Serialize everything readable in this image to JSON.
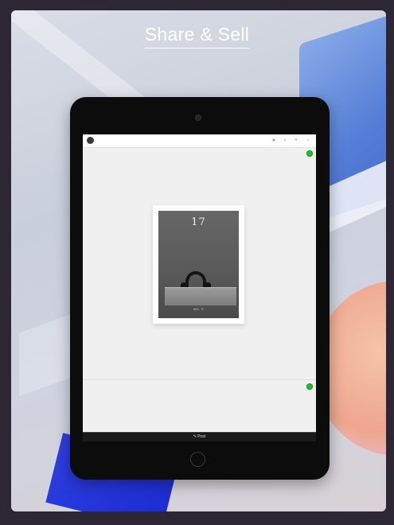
{
  "headline": "Share & Sell",
  "app": {
    "footer": {
      "post_icon": "✎",
      "post_label": "Post"
    },
    "magazine": {
      "cover_title": "17",
      "issue_label": "NO. 5"
    },
    "topbar_icons": [
      "pin-icon",
      "star-icon",
      "info-icon",
      "menu-icon"
    ]
  },
  "colors": {
    "background": "#2c2733",
    "tablet_bezel": "#0c0c0d",
    "online_indicator": "#22c02a",
    "accent_blue": "#1b2bd3"
  }
}
